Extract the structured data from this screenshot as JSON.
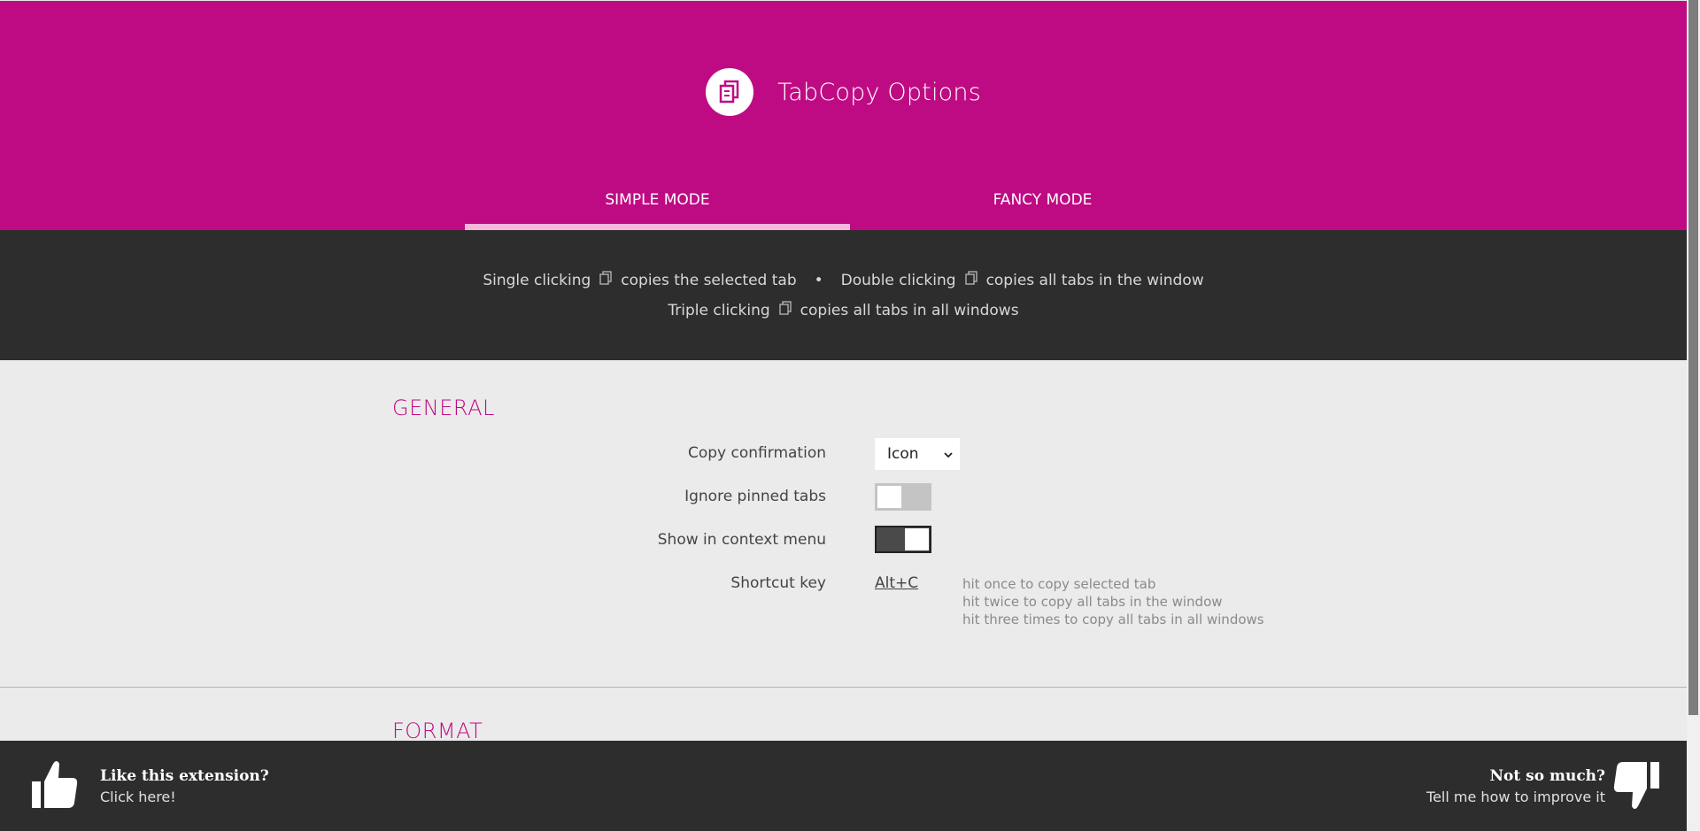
{
  "header": {
    "title": "TabCopy Options",
    "tabs": [
      {
        "label": "SIMPLE MODE",
        "active": true
      },
      {
        "label": "FANCY MODE",
        "active": false
      }
    ]
  },
  "info": {
    "single_prefix": "Single clicking",
    "single_suffix": "copies the selected tab",
    "separator": "•",
    "double_prefix": "Double clicking",
    "double_suffix": "copies all tabs in the window",
    "triple_prefix": "Triple clicking",
    "triple_suffix": "copies all tabs in all windows"
  },
  "general": {
    "title": "GENERAL",
    "copy_confirmation": {
      "label": "Copy confirmation",
      "value": "Icon"
    },
    "ignore_pinned": {
      "label": "Ignore pinned tabs",
      "on": false
    },
    "context_menu": {
      "label": "Show in context menu",
      "on": true
    },
    "shortcut": {
      "label": "Shortcut key",
      "value": "Alt+C",
      "hints": [
        "hit once to copy selected tab",
        "hit twice to copy all tabs in the window",
        "hit three times to copy all tabs in all windows"
      ]
    }
  },
  "format": {
    "title": "FORMAT"
  },
  "footer": {
    "like_title": "Like this extension?",
    "like_sub": "Click here!",
    "dislike_title": "Not so much?",
    "dislike_sub": "Tell me how to improve it"
  },
  "colors": {
    "accent": "#bf0b83",
    "dark": "#2d2d2d",
    "background": "#ebebeb"
  }
}
